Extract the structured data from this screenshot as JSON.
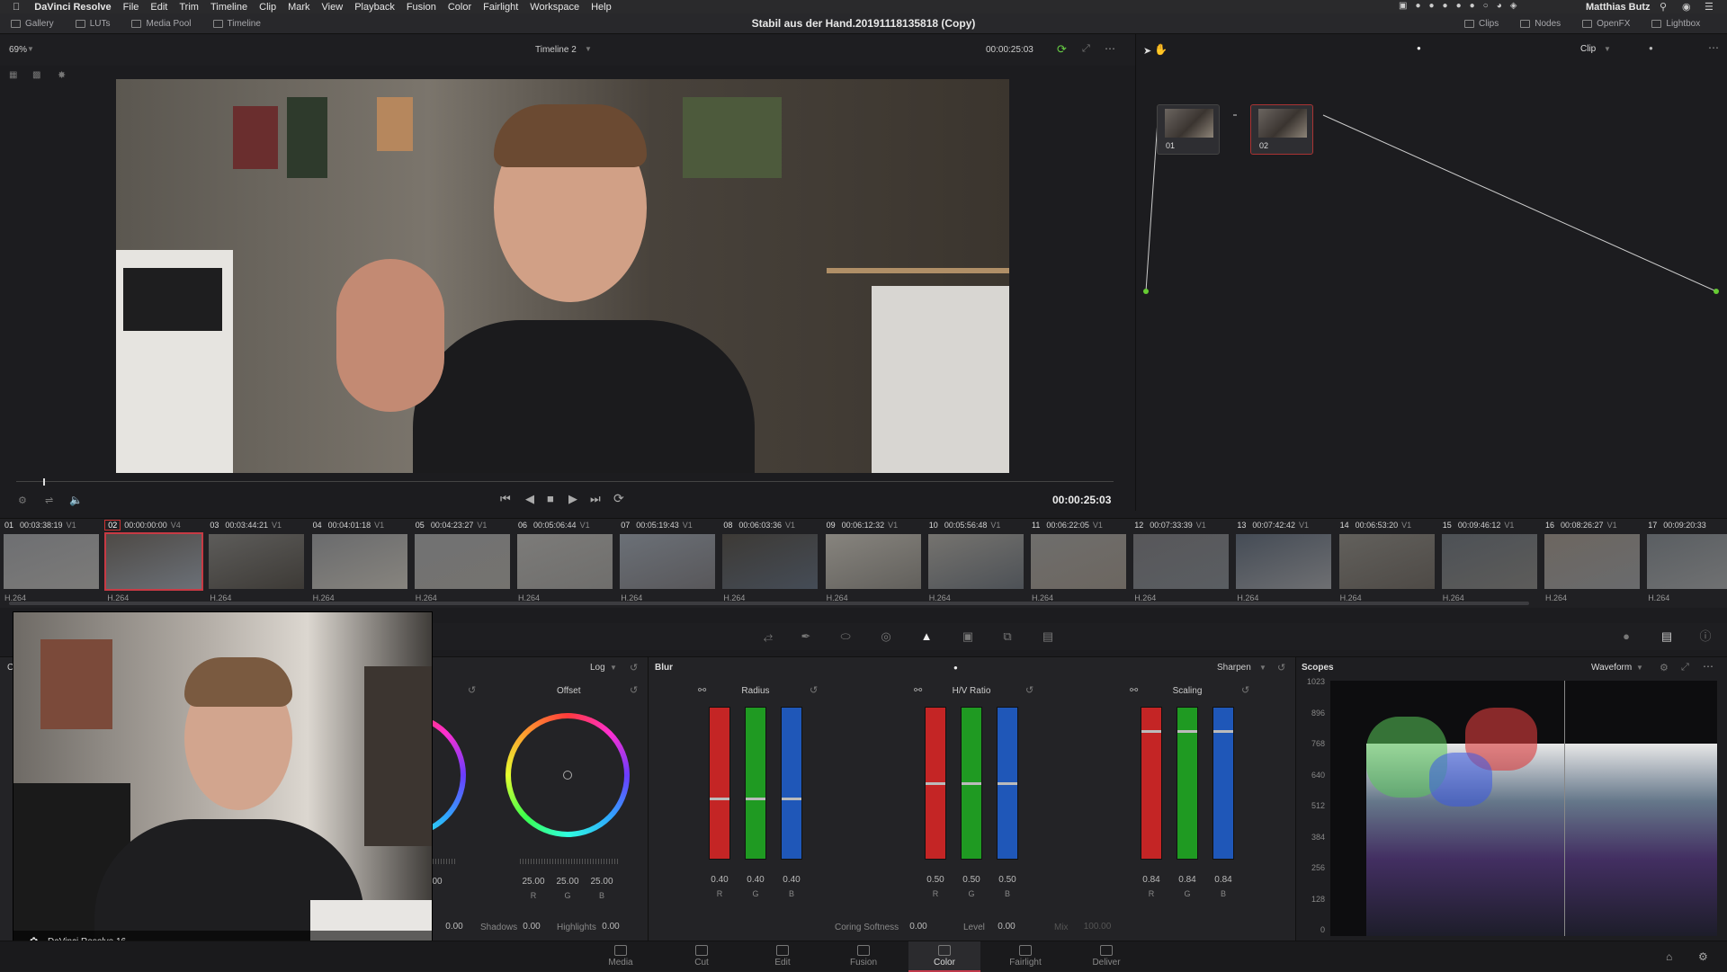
{
  "menubar": {
    "app": "DaVinci Resolve",
    "items": [
      "File",
      "Edit",
      "Trim",
      "Timeline",
      "Clip",
      "Mark",
      "View",
      "Playback",
      "Fusion",
      "Color",
      "Fairlight",
      "Workspace",
      "Help"
    ],
    "user": "Matthias Butz"
  },
  "header": {
    "tabs": [
      "Gallery",
      "LUTs",
      "Media Pool",
      "Timeline"
    ],
    "project_title": "Stabil aus der Hand.20191118135818 (Copy)",
    "right_tabs": [
      "Clips",
      "Nodes",
      "OpenFX",
      "Lightbox"
    ]
  },
  "viewer": {
    "zoom": "69%",
    "timeline_name": "Timeline 2",
    "timecode_top": "00:00:25:03",
    "clip_mode": "Clip",
    "timecode": "00:00:25:03"
  },
  "nodes": [
    {
      "label": "01"
    },
    {
      "label": "02"
    }
  ],
  "clips": [
    {
      "num": "01",
      "tc": "00:03:38:19",
      "track": "V1",
      "codec": "H.264",
      "selected": false
    },
    {
      "num": "02",
      "tc": "00:00:00:00",
      "track": "V4",
      "codec": "H.264",
      "selected": true
    },
    {
      "num": "03",
      "tc": "00:03:44:21",
      "track": "V1",
      "codec": "H.264",
      "selected": false
    },
    {
      "num": "04",
      "tc": "00:04:01:18",
      "track": "V1",
      "codec": "H.264",
      "selected": false
    },
    {
      "num": "05",
      "tc": "00:04:23:27",
      "track": "V1",
      "codec": "H.264",
      "selected": false
    },
    {
      "num": "06",
      "tc": "00:05:06:44",
      "track": "V1",
      "codec": "H.264",
      "selected": false
    },
    {
      "num": "07",
      "tc": "00:05:19:43",
      "track": "V1",
      "codec": "H.264",
      "selected": false
    },
    {
      "num": "08",
      "tc": "00:06:03:36",
      "track": "V1",
      "codec": "H.264",
      "selected": false
    },
    {
      "num": "09",
      "tc": "00:06:12:32",
      "track": "V1",
      "codec": "H.264",
      "selected": false
    },
    {
      "num": "10",
      "tc": "00:05:56:48",
      "track": "V1",
      "codec": "H.264",
      "selected": false
    },
    {
      "num": "11",
      "tc": "00:06:22:05",
      "track": "V1",
      "codec": "H.264",
      "selected": false
    },
    {
      "num": "12",
      "tc": "00:07:33:39",
      "track": "V1",
      "codec": "H.264",
      "selected": false
    },
    {
      "num": "13",
      "tc": "00:07:42:42",
      "track": "V1",
      "codec": "H.264",
      "selected": false
    },
    {
      "num": "14",
      "tc": "00:06:53:20",
      "track": "V1",
      "codec": "H.264",
      "selected": false
    },
    {
      "num": "15",
      "tc": "00:09:46:12",
      "track": "V1",
      "codec": "H.264",
      "selected": false
    },
    {
      "num": "16",
      "tc": "00:08:26:27",
      "track": "V1",
      "codec": "H.264",
      "selected": false
    },
    {
      "num": "17",
      "tc": "00:09:20:33",
      "track": "",
      "codec": "H.264",
      "selected": false
    }
  ],
  "color": {
    "log_label": "Log",
    "offset_label": "Offset",
    "offset_values": [
      "25.00",
      "25.00",
      "25.00"
    ],
    "left_value": "00",
    "blur_label": "Blur",
    "sharpen_label": "Sharpen",
    "radius": {
      "label": "Radius",
      "values": [
        "0.40",
        "0.40",
        "0.40"
      ],
      "level": 0.4
    },
    "hv": {
      "label": "H/V Ratio",
      "values": [
        "0.50",
        "0.50",
        "0.50"
      ],
      "level": 0.5
    },
    "scaling": {
      "label": "Scaling",
      "values": [
        "0.84",
        "0.84",
        "0.84"
      ],
      "level": 0.84
    },
    "rgb": [
      "R",
      "G",
      "B"
    ],
    "shadows_label": "Shadows",
    "shadows_value": "0.00",
    "highlights_label": "Highlights",
    "highlights_value": "0.00",
    "first_value": "0.00",
    "coring_label": "Coring Softness",
    "coring_value": "0.00",
    "level_label": "Level",
    "level_value": "0.00",
    "mix_label": "Mix",
    "mix_value": "100.00",
    "panel_cut_label": "Co"
  },
  "scopes": {
    "title": "Scopes",
    "mode": "Waveform",
    "ticks": [
      "1023",
      "896",
      "768",
      "640",
      "512",
      "384",
      "256",
      "128",
      "0"
    ]
  },
  "bottomnav": [
    "Media",
    "Cut",
    "Edit",
    "Fusion",
    "Color",
    "Fairlight",
    "Deliver"
  ],
  "bottomnav_active": "Color",
  "pip_caption": "DaVinci Resolve 16"
}
